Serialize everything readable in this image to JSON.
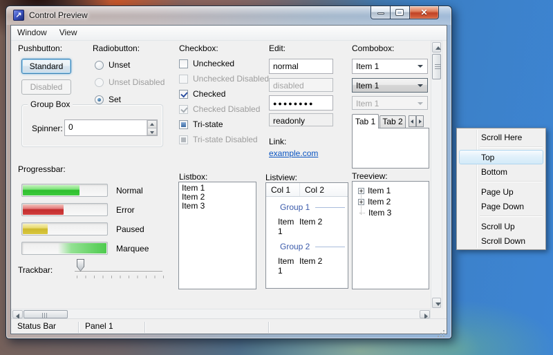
{
  "window": {
    "title": "Control Preview",
    "menu": [
      "Window",
      "View"
    ]
  },
  "sections": {
    "pushbutton": {
      "label": "Pushbutton:",
      "buttons": [
        {
          "label": "Standard",
          "state": "focused"
        },
        {
          "label": "Disabled",
          "state": "disabled"
        }
      ]
    },
    "radiobutton": {
      "label": "Radiobutton:",
      "options": [
        {
          "label": "Unset",
          "checked": false,
          "disabled": false
        },
        {
          "label": "Unset Disabled",
          "checked": false,
          "disabled": true
        },
        {
          "label": "Set",
          "checked": true,
          "disabled": false
        }
      ]
    },
    "groupbox": {
      "label": "Group Box",
      "spinner_label": "Spinner:",
      "spinner_value": "0"
    },
    "checkbox": {
      "label": "Checkbox:",
      "options": [
        {
          "label": "Unchecked",
          "state": "unchecked"
        },
        {
          "label": "Unchecked Disabled",
          "state": "unchecked-disabled"
        },
        {
          "label": "Checked",
          "state": "checked"
        },
        {
          "label": "Checked Disabled",
          "state": "checked-disabled"
        },
        {
          "label": "Tri-state",
          "state": "indeterminate"
        },
        {
          "label": "Tri-state Disabled",
          "state": "indeterminate-disabled"
        }
      ]
    },
    "edit": {
      "label": "Edit:",
      "fields": [
        {
          "value": "normal",
          "state": "normal"
        },
        {
          "value": "disabled",
          "state": "disabled"
        },
        {
          "value": "●●●●●●●●",
          "state": "password"
        },
        {
          "value": "readonly",
          "state": "readonly"
        }
      ]
    },
    "link": {
      "label": "Link:",
      "text": "example.com"
    },
    "combobox": {
      "label": "Combobox:",
      "items": [
        {
          "value": "Item 1",
          "state": "editable"
        },
        {
          "value": "Item 1",
          "state": "dropdown-list"
        },
        {
          "value": "Item 1",
          "state": "disabled"
        }
      ]
    },
    "tabs": {
      "items": [
        "Tab 1",
        "Tab 2"
      ],
      "active": "Tab 1"
    },
    "progressbar": {
      "label": "Progressbar:",
      "bars": [
        {
          "name": "Normal",
          "value": 67,
          "color": "green"
        },
        {
          "name": "Error",
          "value": 48,
          "color": "red"
        },
        {
          "name": "Paused",
          "value": 29,
          "color": "yellow"
        },
        {
          "name": "Marquee",
          "value": null,
          "color": "green-marquee"
        }
      ]
    },
    "trackbar": {
      "label": "Trackbar:",
      "position": 2
    },
    "listbox": {
      "label": "Listbox:",
      "items": [
        "Item 1",
        "Item 2",
        "Item 3"
      ]
    },
    "listview": {
      "label": "Listview:",
      "columns": [
        "Col 1",
        "Col 2"
      ],
      "groups": [
        {
          "name": "Group 1",
          "rows": [
            [
              "Item 1",
              "Item 2"
            ]
          ]
        },
        {
          "name": "Group 2",
          "rows": [
            [
              "Item 1",
              "Item 2"
            ]
          ]
        }
      ]
    },
    "treeview": {
      "label": "Treeview:",
      "items": [
        {
          "label": "Item 1",
          "expandable": true
        },
        {
          "label": "Item 2",
          "expandable": true
        },
        {
          "label": "Item 3",
          "expandable": false
        }
      ]
    }
  },
  "context_menu": {
    "items": [
      "Scroll Here",
      "Top",
      "Bottom",
      "Page Up",
      "Page Down",
      "Scroll Up",
      "Scroll Down"
    ],
    "highlighted": "Top"
  },
  "status_bar": {
    "panels": [
      "Status Bar",
      "Panel 1"
    ]
  },
  "colors": {
    "accent_blue": "#3d85d4",
    "progress_green": "#3ecb3e",
    "progress_red": "#d13e3e",
    "progress_yellow": "#d8c73e",
    "link_blue": "#0853c1",
    "group_text_blue": "#3b5bab"
  }
}
